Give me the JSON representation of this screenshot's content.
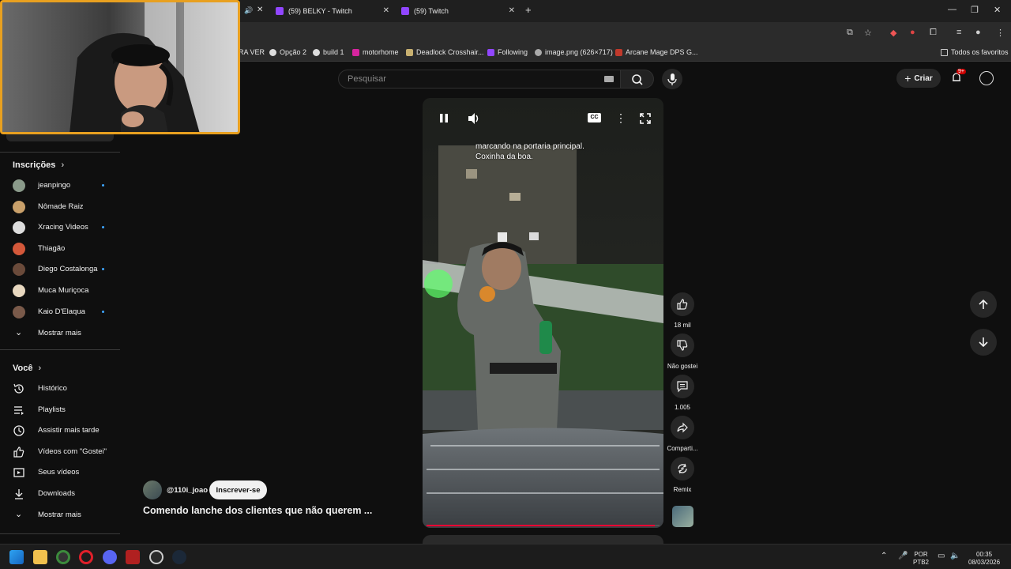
{
  "browser": {
    "tabs": [
      {
        "label": "(59) BELKY - Twitch"
      },
      {
        "label": "(59) Twitch"
      }
    ],
    "new_tab": "+",
    "window_controls": [
      "minimize-icon",
      "restore-icon",
      "close-icon"
    ]
  },
  "bookmarks": [
    {
      "label": "RA VER"
    },
    {
      "label": "Opção 2"
    },
    {
      "label": "build 1"
    },
    {
      "label": "motorhome"
    },
    {
      "label": "Deadlock Crosshair..."
    },
    {
      "label": "Following"
    },
    {
      "label": "image.png (626×717)"
    },
    {
      "label": "Arcane Mage DPS G..."
    }
  ],
  "bookmarks_all": "Todos os favoritos",
  "header": {
    "search_placeholder": "Pesquisar",
    "create_label": "Criar",
    "notifications_badge": "9+"
  },
  "sidebar": {
    "subscriptions_title": "Inscrições",
    "subscriptions": [
      {
        "label": "jeanpingo",
        "dot": true,
        "color": "#8a9a8a"
      },
      {
        "label": "Nômade Raiz",
        "dot": false,
        "color": "#c9a06a"
      },
      {
        "label": "Xracing Videos",
        "dot": true,
        "color": "#dddddd"
      },
      {
        "label": "Thiagão",
        "dot": false,
        "color": "#d4583a"
      },
      {
        "label": "Diego Costalonga",
        "dot": true,
        "color": "#6a4a3a"
      },
      {
        "label": "Muca Muriçoca",
        "dot": false,
        "color": "#e8d8c0"
      },
      {
        "label": "Kaio D'Elaqua",
        "dot": true,
        "color": "#7a5a4a"
      }
    ],
    "subscriptions_more": "Mostrar mais",
    "you_title": "Você",
    "you_items": [
      {
        "label": "Histórico",
        "icon": "history-icon"
      },
      {
        "label": "Playlists",
        "icon": "playlists-icon"
      },
      {
        "label": "Assistir mais tarde",
        "icon": "watch-later-icon"
      },
      {
        "label": "Vídeos com \"Gostei\"",
        "icon": "like-icon"
      },
      {
        "label": "Seus vídeos",
        "icon": "your-videos-icon"
      },
      {
        "label": "Downloads",
        "icon": "download-icon"
      }
    ],
    "you_more": "Mostrar mais"
  },
  "video": {
    "caption_line1": "marcando na portaria principal.",
    "caption_line2": "Coxinha da boa.",
    "progress": 0.98
  },
  "actions": {
    "likes": "18 mil",
    "dislike": "Não gostei",
    "comments": "1.005",
    "share": "Comparti...",
    "remix": "Remix"
  },
  "channel": {
    "name": "@110i_joao",
    "subscribe": "Inscrever-se",
    "title": "Comendo lanche dos clientes que não querem ..."
  },
  "taskbar": {
    "lang1": "POR",
    "lang2": "PTB2",
    "time": "00:35",
    "date": "08/03/2026"
  },
  "colors": {
    "accent_red": "#ff0033",
    "twitch": "#9146ff",
    "webcam_border": "#e8a020"
  }
}
